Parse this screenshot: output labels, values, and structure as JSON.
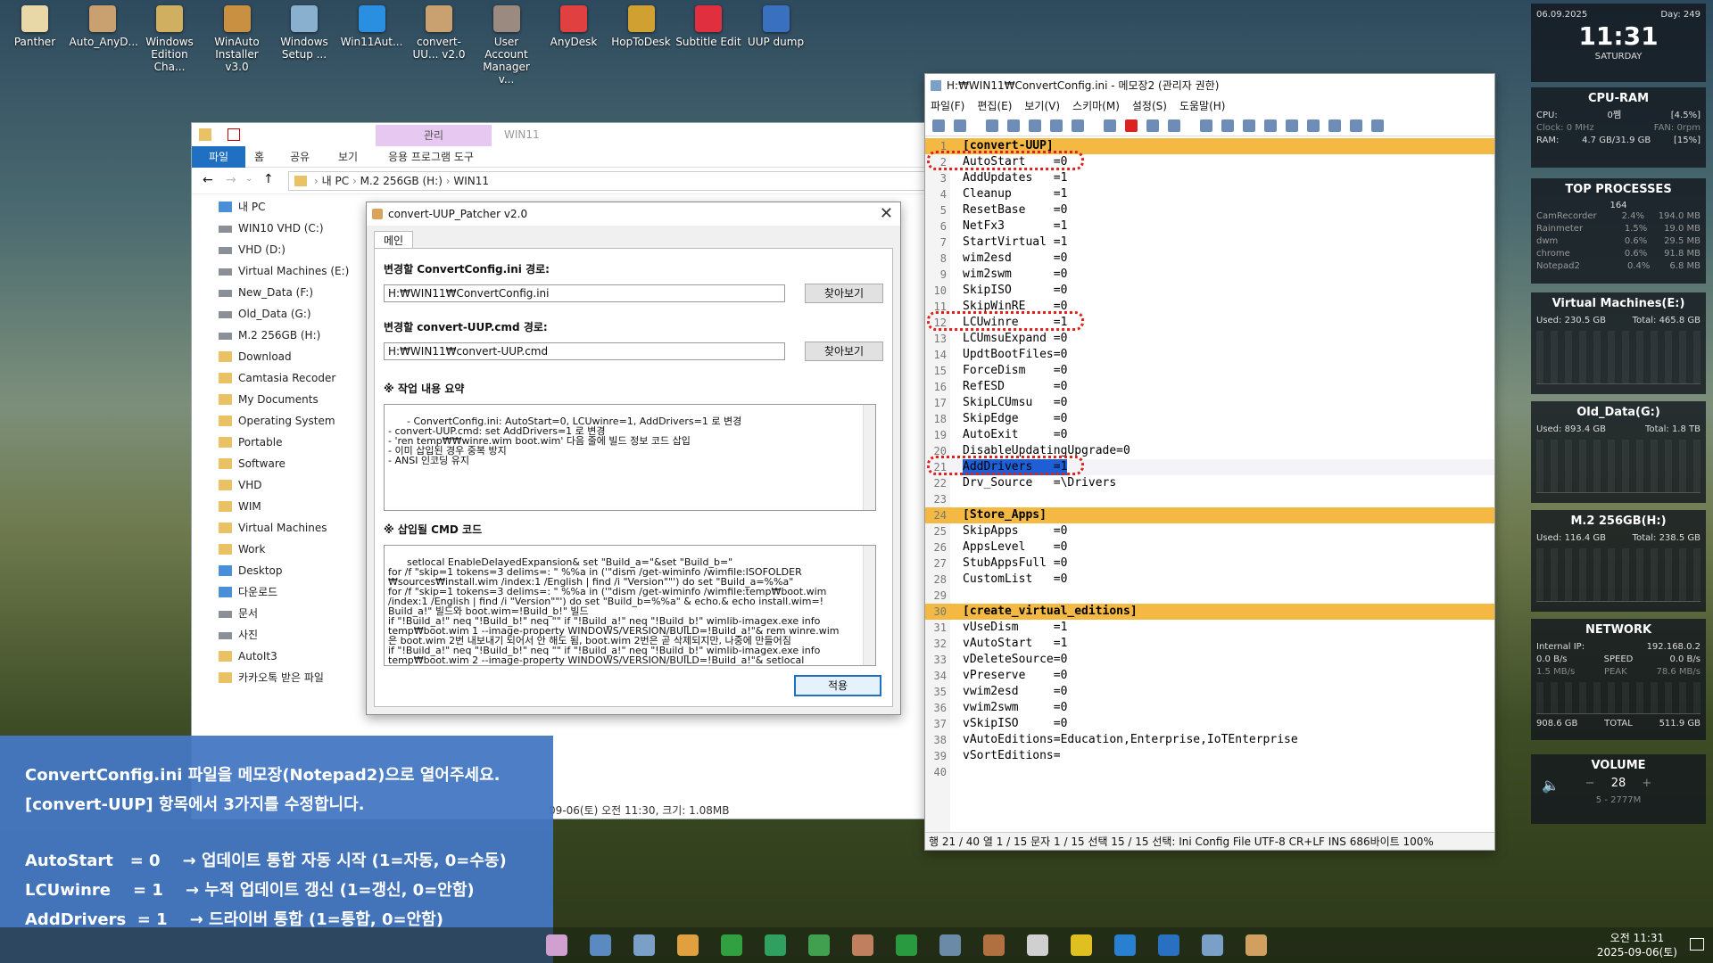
{
  "desktop_icons": [
    {
      "label": "Panther"
    },
    {
      "label": "Auto_AnyD..."
    },
    {
      "label": "Windows Edition Cha..."
    },
    {
      "label": "WinAuto Installer v3.0"
    },
    {
      "label": "Windows Setup ..."
    },
    {
      "label": "Win11Aut..."
    },
    {
      "label": "convert-UU... v2.0"
    },
    {
      "label": "User Account Manager v..."
    },
    {
      "label": "AnyDesk"
    },
    {
      "label": "HopToDesk"
    },
    {
      "label": "Subtitle Edit"
    },
    {
      "label": "UUP dump"
    }
  ],
  "explorer": {
    "manage_tab": "관리",
    "window_title": "WIN11",
    "ribbon_tabs": [
      "파일",
      "홈",
      "공유",
      "보기",
      "응용 프로그램 도구"
    ],
    "breadcrumb": [
      "내 PC",
      "M.2 256GB (H:)",
      "WIN11"
    ],
    "nav_items": [
      {
        "label": "내 PC",
        "kind": "pc"
      },
      {
        "label": "WIN10 VHD (C:)",
        "kind": "drive"
      },
      {
        "label": "VHD (D:)",
        "kind": "drive"
      },
      {
        "label": "Virtual Machines (E:)",
        "kind": "drive"
      },
      {
        "label": "New_Data (F:)",
        "kind": "drive"
      },
      {
        "label": "Old_Data (G:)",
        "kind": "drive"
      },
      {
        "label": "M.2 256GB (H:)",
        "kind": "drive"
      },
      {
        "label": "Download",
        "kind": "folder"
      },
      {
        "label": "Camtasia Recoder",
        "kind": "folder"
      },
      {
        "label": "My Documents",
        "kind": "folder"
      },
      {
        "label": "Operating System",
        "kind": "folder"
      },
      {
        "label": "Portable",
        "kind": "folder"
      },
      {
        "label": "Software",
        "kind": "folder"
      },
      {
        "label": "VHD",
        "kind": "folder"
      },
      {
        "label": "WIM",
        "kind": "folder"
      },
      {
        "label": "Virtual Machines",
        "kind": "folder"
      },
      {
        "label": "Work",
        "kind": "folder"
      },
      {
        "label": "Desktop",
        "kind": "pc"
      },
      {
        "label": "다운로드",
        "kind": "pc"
      },
      {
        "label": "문서",
        "kind": "drive"
      },
      {
        "label": "사진",
        "kind": "drive"
      },
      {
        "label": "AutoIt3",
        "kind": "folder"
      },
      {
        "label": "카카오톡 받은 파일",
        "kind": "folder"
      }
    ],
    "status_text": "09-06(토) 오전 11:30, 크기: 1.08MB"
  },
  "patcher": {
    "title": "convert-UUP_Patcher v2.0",
    "tab": "메인",
    "config_label": "변경할 ConvertConfig.ini 경로:",
    "config_path": "H:₩WIN11₩ConvertConfig.ini",
    "cmd_label": "변경할 convert-UUP.cmd 경로:",
    "cmd_path": "H:₩WIN11₩convert-UUP.cmd",
    "browse_label": "찾아보기",
    "summary_label": "※ 작업 내용 요약",
    "summary_text": "- ConvertConfig.ini: AutoStart=0, LCUwinre=1, AddDrivers=1 로 변경\n- convert-UUP.cmd: set AddDrivers=1 로 변경\n- 'ren temp₩₩winre.wim boot.wim' 다음 줄에 빌드 정보 코드 삽입\n- 이미 삽입된 경우 중복 방지\n- ANSI 인코딩 유지",
    "code_label": "※ 삽입될 CMD 코드",
    "code_text": "setlocal EnableDelayedExpansion& set \"Build_a=\"&set \"Build_b=\"\nfor /f \"skip=1 tokens=3 delims=: \" %%a in ('\"dism /get-wiminfo /wimfile:ISOFOLDER\n₩sources₩install.wim /index:1 /English | find /i \"Version\"\"') do set \"Build_a=%%a\"\nfor /f \"skip=1 tokens=3 delims=: \" %%a in ('\"dism /get-wiminfo /wimfile:temp₩boot.wim\n/index:1 /English | find /i \"Version\"\"') do set \"Build_b=%%a\" & echo.& echo install.wim=!\nBuild_a!\" 빌드와 boot.wim=!Build_b!\" 빌드\nif \"!Build_a!\" neq \"!Build_b!\" neq \"\" if \"!Build_a!\" neq \"!Build_b!\" wimlib-imagex.exe info\ntemp₩boot.wim 1 --image-property WINDOWS/VERSION/BUILD=!Build_a!\"& rem winre.wim\n은 boot.wim 2번 내보내기 되어서 안 해도 됨, boot.wim 2번은 곧 삭제되지만, 나중에 만들어짐\nif \"!Build_a!\" neq \"!Build_b!\" neq \"\" if \"!Build_a!\" neq \"!Build_b!\" wimlib-imagex.exe info\ntemp₩boot.wim 2 --image-property WINDOWS/VERSION/BUILD=!Build_a!\"& setlocal",
    "apply_label": "적용"
  },
  "notepad": {
    "title": "H:₩WIN11₩ConvertConfig.ini - 메모장2 (관리자 권한)",
    "menu": [
      "파일(F)",
      "편집(E)",
      "보기(V)",
      "스키마(M)",
      "설정(S)",
      "도움말(H)"
    ],
    "lines": [
      {
        "n": "1",
        "t": "[convert-UUP]",
        "sec": true
      },
      {
        "n": "2",
        "t": "AutoStart    =0"
      },
      {
        "n": "3",
        "t": "AddUpdates   =1"
      },
      {
        "n": "4",
        "t": "Cleanup      =1"
      },
      {
        "n": "5",
        "t": "ResetBase    =0"
      },
      {
        "n": "6",
        "t": "NetFx3       =1"
      },
      {
        "n": "7",
        "t": "StartVirtual =1"
      },
      {
        "n": "8",
        "t": "wim2esd      =0"
      },
      {
        "n": "9",
        "t": "wim2swm      =0"
      },
      {
        "n": "10",
        "t": "SkipISO      =0"
      },
      {
        "n": "11",
        "t": "SkipWinRE    =0"
      },
      {
        "n": "12",
        "t": "LCUwinre     =1"
      },
      {
        "n": "13",
        "t": "LCUmsuExpand =0"
      },
      {
        "n": "14",
        "t": "UpdtBootFiles=0"
      },
      {
        "n": "15",
        "t": "ForceDism    =0"
      },
      {
        "n": "16",
        "t": "RefESD       =0"
      },
      {
        "n": "17",
        "t": "SkipLCUmsu   =0"
      },
      {
        "n": "18",
        "t": "SkipEdge     =0"
      },
      {
        "n": "19",
        "t": "AutoExit     =0"
      },
      {
        "n": "20",
        "t": "DisableUpdatingUpgrade=0"
      },
      {
        "n": "21",
        "t": "AddDrivers   =1",
        "cur": true
      },
      {
        "n": "22",
        "t": "Drv_Source   =\\Drivers"
      },
      {
        "n": "23",
        "t": ""
      },
      {
        "n": "24",
        "t": "[Store_Apps]",
        "sec": true
      },
      {
        "n": "25",
        "t": "SkipApps     =0"
      },
      {
        "n": "26",
        "t": "AppsLevel    =0"
      },
      {
        "n": "27",
        "t": "StubAppsFull =0"
      },
      {
        "n": "28",
        "t": "CustomList   =0"
      },
      {
        "n": "29",
        "t": ""
      },
      {
        "n": "30",
        "t": "[create_virtual_editions]",
        "sec": true
      },
      {
        "n": "31",
        "t": "vUseDism     =1"
      },
      {
        "n": "32",
        "t": "vAutoStart   =1"
      },
      {
        "n": "33",
        "t": "vDeleteSource=0"
      },
      {
        "n": "34",
        "t": "vPreserve    =0"
      },
      {
        "n": "35",
        "t": "vwim2esd     =0"
      },
      {
        "n": "36",
        "t": "vwim2swm     =0"
      },
      {
        "n": "37",
        "t": "vSkipISO     =0"
      },
      {
        "n": "38",
        "t": "vAutoEditions=Education,Enterprise,IoTEnterprise"
      },
      {
        "n": "39",
        "t": "vSortEditions="
      },
      {
        "n": "40",
        "t": ""
      }
    ],
    "status": "행 21 / 40   열 1 / 15   문자 1 / 15   선택 15 / 15   선택: Ini Config File   UTF-8   CR+LF   INS   686바이트   100%"
  },
  "gadgets": {
    "clock": {
      "date": "06.09.2025",
      "day": "Day: 249",
      "time": "11:31",
      "weekday": "SATURDAY"
    },
    "cpu_ram": {
      "title": "CPU-RAM",
      "cpu_label": "CPU:",
      "cpu_value": "0쩸",
      "cpu_pct": "[4.5%]",
      "clock": "Clock: 0 MHz",
      "fan": "FAN: 0rpm",
      "ram_label": "RAM:",
      "ram_value": "4.7 GB/31.9 GB",
      "ram_pct": "[15%]"
    },
    "top_processes": {
      "title": "TOP PROCESSES",
      "count": "164",
      "rows": [
        {
          "name": "CamRecorder",
          "cpu": "2.4%",
          "mem": "194.0 MB"
        },
        {
          "name": "Rainmeter",
          "cpu": "1.5%",
          "mem": "19.0 MB"
        },
        {
          "name": "dwm",
          "cpu": "0.6%",
          "mem": "29.5 MB"
        },
        {
          "name": "chrome",
          "cpu": "0.6%",
          "mem": "91.8 MB"
        },
        {
          "name": "Notepad2",
          "cpu": "0.4%",
          "mem": "6.8 MB"
        }
      ]
    },
    "disks": [
      {
        "title": "Virtual Machines(E:)",
        "used": "Used: 230.5 GB",
        "total": "Total: 465.8 GB"
      },
      {
        "title": "Old_Data(G:)",
        "used": "Used: 893.4 GB",
        "total": "Total: 1.8 TB"
      },
      {
        "title": "M.2 256GB(H:)",
        "used": "Used: 116.4 GB",
        "total": "Total: 238.5 GB"
      }
    ],
    "network": {
      "title": "NETWORK",
      "ip_label": "Internal IP:",
      "ip": "192.168.0.2",
      "down": "0.0 B/s",
      "up": "0.0 B/s",
      "speed": "SPEED",
      "peak": "PEAK",
      "peak_down": "1.5 MB/s",
      "peak_up": "78.6 MB/s",
      "total_down": "908.6 GB",
      "total_label": "TOTAL",
      "total_up": "511.9 GB"
    },
    "volume": {
      "title": "VOLUME",
      "value": "28",
      "device": "5 - 2777M"
    }
  },
  "overlay": {
    "line1": "ConvertConfig.ini 파일을 메모장(Notepad2)으로 열어주세요.",
    "line2": "[convert-UUP] 항목에서 3가지를 수정합니다.",
    "item1": "AutoStart   = 0    → 업데이트 통합 자동 시작 (1=자동, 0=수동)",
    "item2": "LCUwinre    = 1    → 누적 업데이트 갱신 (1=갱신, 0=안함)",
    "item3": "AddDrivers  = 1    → 드라이버 통합 (1=통합, 0=안함)"
  },
  "taskbar": {
    "time": "오전 11:31",
    "date": "2025-09-06(토)"
  },
  "colors": {
    "accent": "#1f6fc3",
    "section": "#f4b942",
    "mark": "#e0201a",
    "overlay": "#4477c3"
  }
}
